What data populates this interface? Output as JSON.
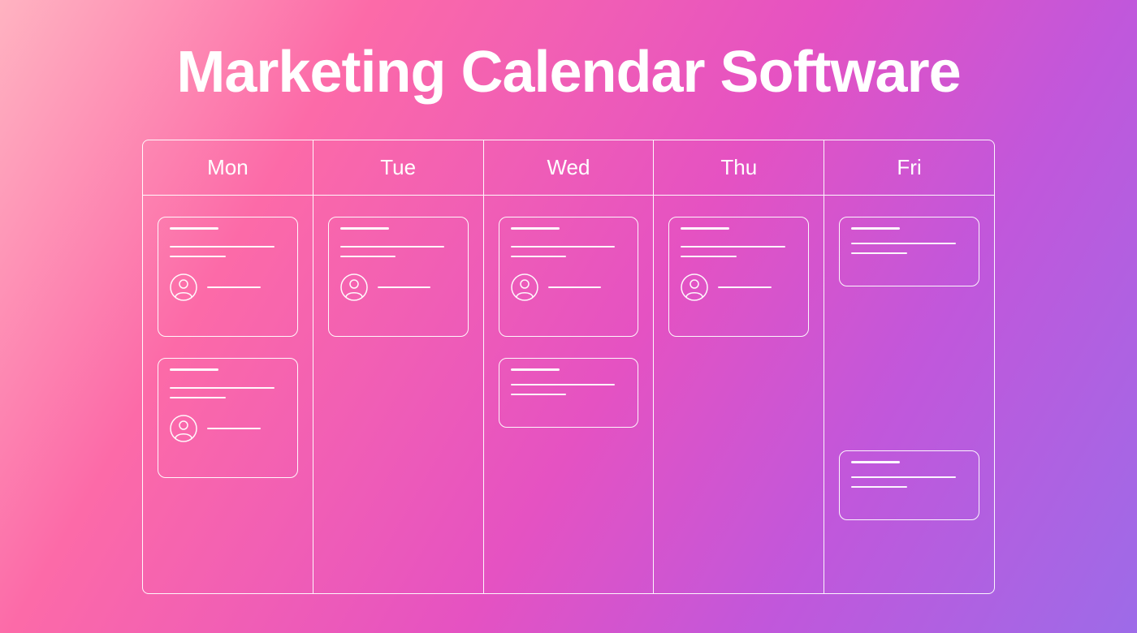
{
  "title": "Marketing Calendar Software",
  "days": [
    {
      "label": "Mon"
    },
    {
      "label": "Tue"
    },
    {
      "label": "Wed"
    },
    {
      "label": "Thu"
    },
    {
      "label": "Fri"
    }
  ],
  "icons": {
    "avatar": "avatar-icon"
  }
}
